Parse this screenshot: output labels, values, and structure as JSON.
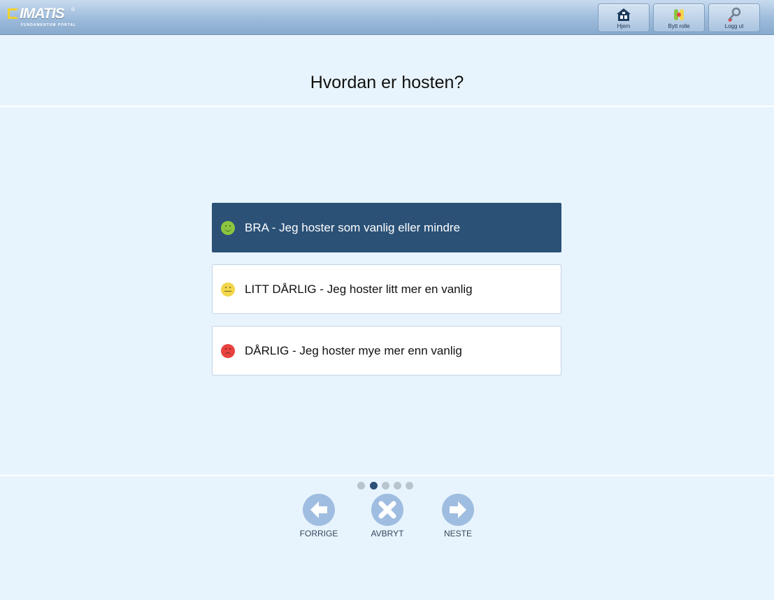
{
  "header": {
    "logo_text": "IMATIS",
    "logo_registered": "®",
    "logo_subtitle": "FUNDAMENTUM PORTAL",
    "buttons": [
      {
        "label": "Hjem",
        "icon": "home-icon"
      },
      {
        "label": "Bytt rolle",
        "icon": "switch-role-icon"
      },
      {
        "label": "Logg ut",
        "icon": "key-icon"
      }
    ]
  },
  "question": "Hvordan er hosten?",
  "options": [
    {
      "label": "BRA - Jeg hoster som vanlig eller mindre",
      "icon": "happy-face-icon",
      "color": "#8cc63f",
      "selected": true
    },
    {
      "label": "LITT DÅRLIG - Jeg hoster litt mer en vanlig",
      "icon": "neutral-face-icon",
      "color": "#f2d64b",
      "selected": false
    },
    {
      "label": "DÅRLIG - Jeg hoster mye mer enn vanlig",
      "icon": "sad-face-icon",
      "color": "#e8433f",
      "selected": false
    }
  ],
  "pagination": {
    "total": 5,
    "current": 2
  },
  "nav": {
    "previous_label": "FORRIGE",
    "cancel_label": "AVBRYT",
    "next_label": "NESTE"
  },
  "colors": {
    "selected_option": "#2b5177",
    "nav_button": "#9fbde0",
    "background": "#e8f4fd"
  }
}
